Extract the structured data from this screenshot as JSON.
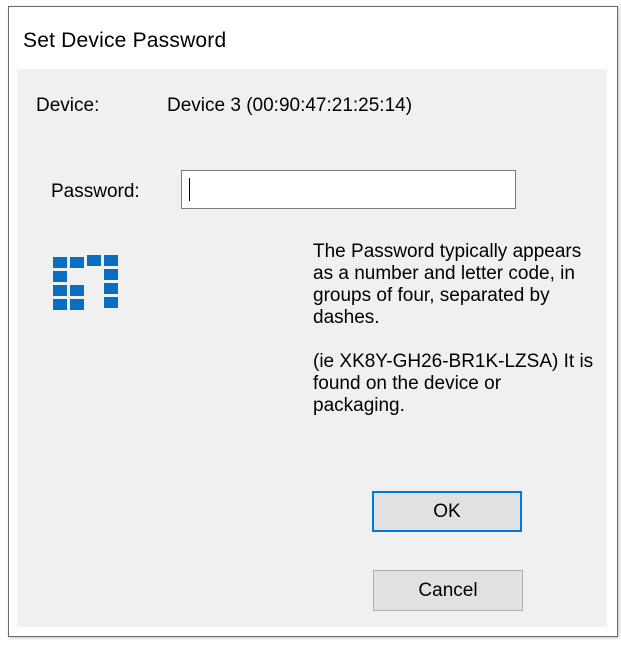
{
  "window": {
    "title": "Set Device Password"
  },
  "device": {
    "label": "Device:",
    "value": "Device 3  (00:90:47:21:25:14)"
  },
  "password": {
    "label": "Password:",
    "value": ""
  },
  "logo": {
    "icon": "device-logo-icon",
    "color": "#0a6fc2"
  },
  "hint": {
    "paragraph1": "The Password typically appears as a number and letter code, in groups of four, separated by dashes.",
    "paragraph2": "(ie XK8Y-GH26-BR1K-LZSA) It is found on the device or packaging."
  },
  "buttons": {
    "ok_label": "OK",
    "cancel_label": "Cancel"
  },
  "colors": {
    "focus_border": "#0078d7",
    "dialog_background": "#f0f0f0"
  }
}
